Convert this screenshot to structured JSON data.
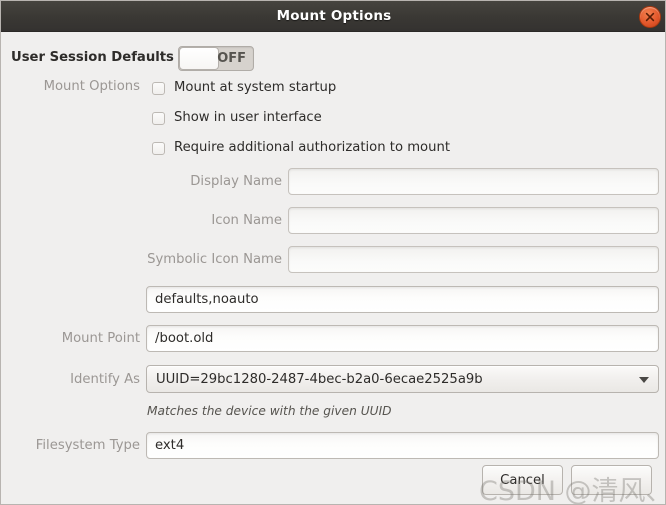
{
  "window": {
    "title": "Mount Options",
    "close_icon": "close-icon",
    "accent_close_color": "#e2562a",
    "titlebar_color": "#3a3834",
    "background_color": "#f0efee"
  },
  "session_defaults": {
    "label": "User Session Defaults",
    "toggle_state": "OFF",
    "toggle_on": false
  },
  "mount_options": {
    "group_label": "Mount Options",
    "checkboxes": [
      {
        "label": "Mount at system startup",
        "checked": false
      },
      {
        "label": "Show in user interface",
        "checked": false
      },
      {
        "label": "Require additional authorization to mount",
        "checked": false
      }
    ]
  },
  "fields": [
    {
      "label": "Display Name",
      "value": "",
      "placeholder": "",
      "disabled": true
    },
    {
      "label": "Icon Name",
      "value": "",
      "placeholder": "",
      "disabled": true
    },
    {
      "label": "Symbolic Icon Name",
      "value": "",
      "placeholder": "",
      "disabled": true
    },
    {
      "label": "",
      "value": "defaults,noauto",
      "placeholder": "",
      "disabled": false
    },
    {
      "label": "Mount Point",
      "value": "/boot.old",
      "placeholder": "",
      "disabled": false
    },
    {
      "label": "Filesystem Type",
      "value": "ext4",
      "placeholder": "",
      "disabled": false
    }
  ],
  "identify_as": {
    "label": "Identify As",
    "value": "UUID=29bc1280-2487-4bec-b2a0-6ecae2525a9b",
    "arrow_icon": "chevron-down-icon",
    "hint": "Matches the device with the given UUID"
  },
  "buttons": {
    "cancel_label": "Cancel",
    "secondary_label": ""
  },
  "watermark": {
    "text": "CSDN @清风、腾云"
  }
}
